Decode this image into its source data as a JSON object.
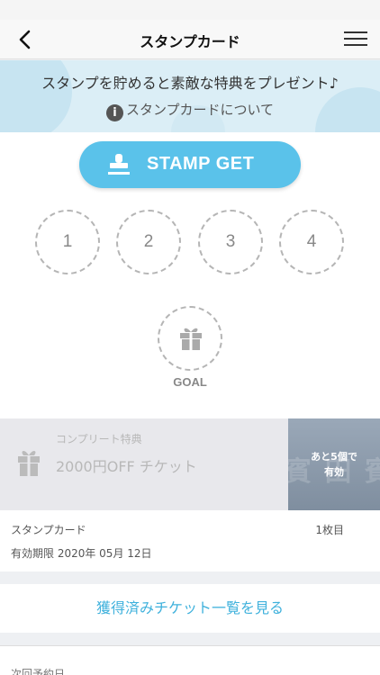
{
  "header": {
    "title": "スタンプカード"
  },
  "banner": {
    "text": "スタンプを貯めると素敵な特典をプレゼント♪",
    "info_label": "スタンプカードについて"
  },
  "stamp_button": {
    "label": "STAMP GET"
  },
  "stamp_slots": [
    "1",
    "2",
    "3",
    "4"
  ],
  "goal": {
    "label": "GOAL"
  },
  "reward": {
    "caption": "コンプリート特典",
    "title": "2000円OFF チケット",
    "remaining_line1": "あと5個で",
    "remaining_line2": "有効",
    "image_faded_text": "賓 田 賓 片"
  },
  "card_info": {
    "label": "スタンプカード",
    "count": "1枚目",
    "expiry": "有効期限 2020年 05月 12日"
  },
  "tickets_link": "獲得済みチケット一覧を見る",
  "next_date_label": "次回予約日",
  "colors": {
    "accent": "#5ac2ea",
    "link": "#3fb1dc",
    "banner_bg": "#dbeef6"
  }
}
